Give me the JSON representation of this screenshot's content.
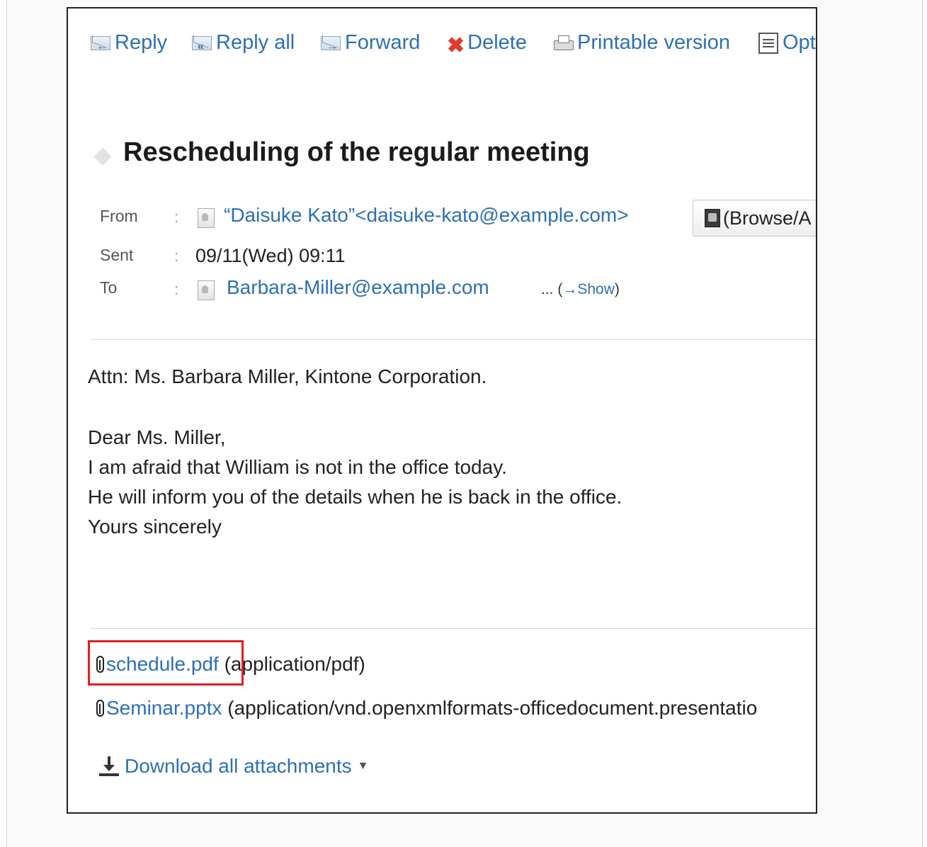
{
  "toolbar": {
    "reply": "Reply",
    "reply_all": "Reply all",
    "forward": "Forward",
    "delete": "Delete",
    "printable": "Printable version",
    "options": "Opt"
  },
  "message": {
    "subject": "Rescheduling of the regular meeting",
    "from_label": "From",
    "from_value": "“Daisuke Kato”<daisuke-kato@example.com>",
    "browse_label": "(Browse/A",
    "sent_label": "Sent",
    "sent_value": "09/11(Wed) 09:11",
    "to_label": "To",
    "to_value": "Barbara-Miller@example.com",
    "to_more": "... (",
    "show_link": "→Show",
    "to_close": ")",
    "colon": ":"
  },
  "body_lines": [
    "Attn: Ms. Barbara Miller, Kintone Corporation.",
    "Dear Ms. Miller,",
    "I am afraid that William is not in the office today.",
    "He will inform you of the details when he is back in the office.",
    "Yours sincerely"
  ],
  "attachments": [
    {
      "name": "schedule.pdf",
      "type": " (application/pdf)"
    },
    {
      "name": "Seminar.pptx",
      "type": " (application/vnd.openxmlformats-officedocument.presentatio"
    }
  ],
  "download_all": "Download all attachments"
}
